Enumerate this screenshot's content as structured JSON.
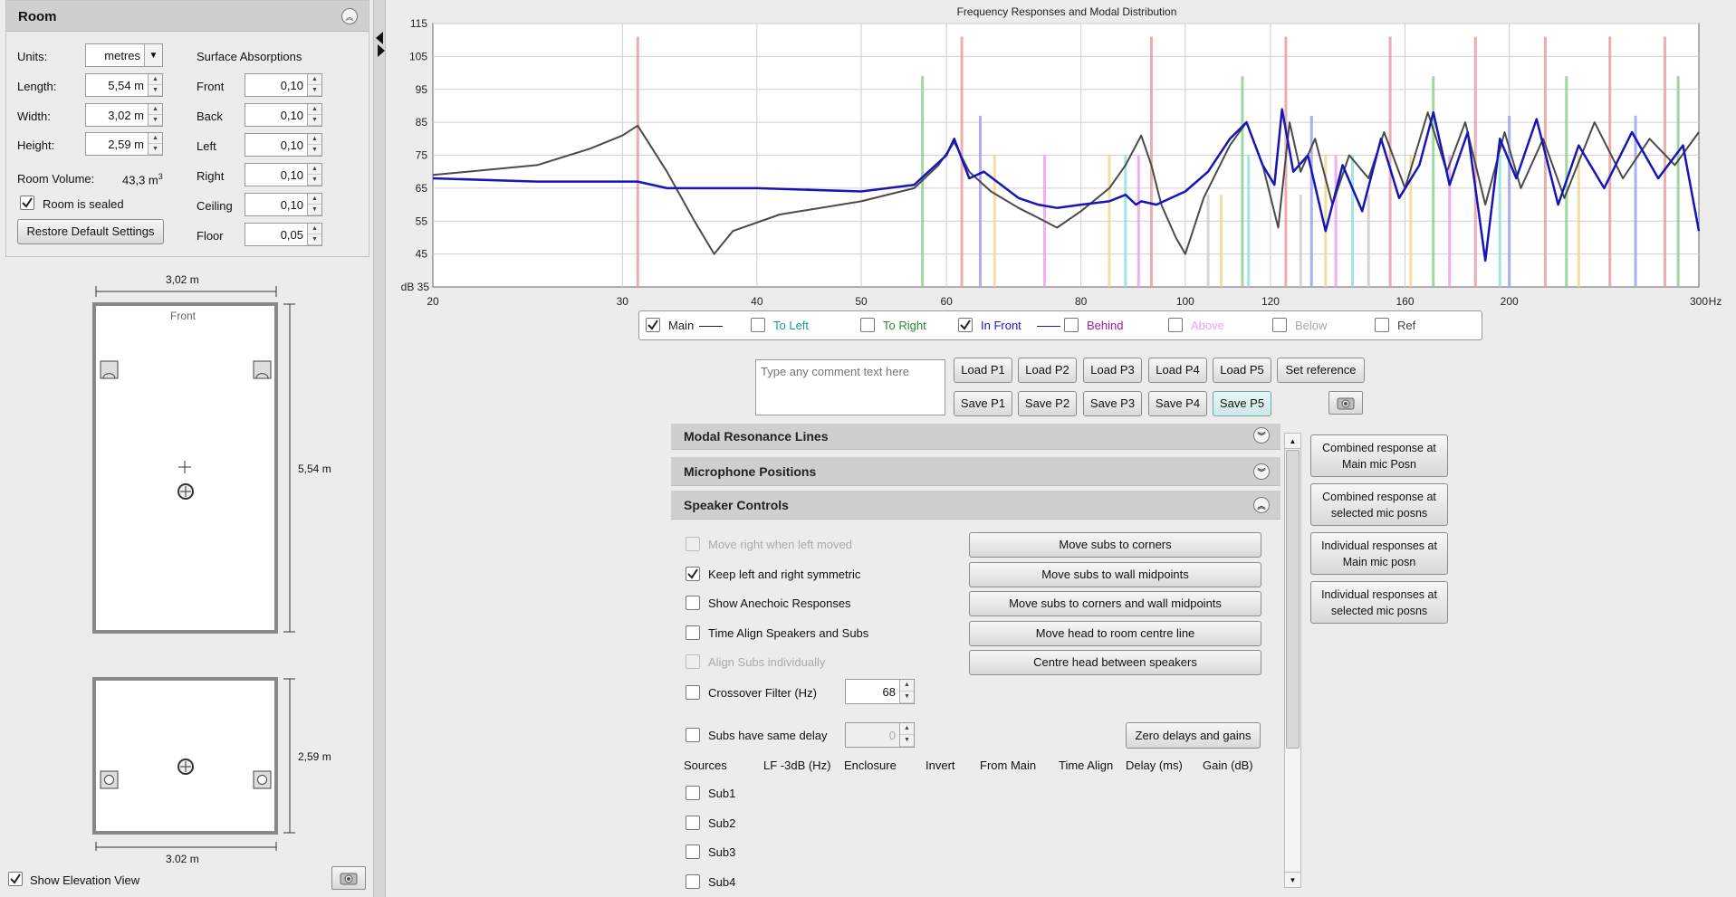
{
  "room": {
    "title": "Room",
    "units_label": "Units:",
    "units_value": "metres",
    "length_label": "Length:",
    "length_value": "5,54 m",
    "width_label": "Width:",
    "width_value": "3,02 m",
    "height_label": "Height:",
    "height_value": "2,59 m",
    "volume_label": "Room Volume:",
    "volume_value": "43,3 m",
    "volume_sup": "3",
    "sealed_label": "Room is sealed",
    "sealed_checked": true,
    "restore_label": "Restore Default Settings",
    "absorption_title": "Surface Absorptions",
    "absorptions": [
      {
        "label": "Front",
        "value": "0,10"
      },
      {
        "label": "Back",
        "value": "0,10"
      },
      {
        "label": "Left",
        "value": "0,10"
      },
      {
        "label": "Right",
        "value": "0,10"
      },
      {
        "label": "Ceiling",
        "value": "0,10"
      },
      {
        "label": "Floor",
        "value": "0,05"
      }
    ]
  },
  "plan": {
    "width_dim": "3,02 m",
    "length_dim": "5,54 m",
    "front_label": "Front",
    "elev_width_dim": "3.02 m",
    "elev_height_dim": "2,59 m",
    "show_elevation_label": "Show Elevation View",
    "show_elevation_checked": true
  },
  "chart_data": {
    "type": "line",
    "title": "Frequency Responses and Modal Distribution",
    "xscale": "log",
    "xlim": [
      20,
      300
    ],
    "ylim": [
      35,
      115
    ],
    "xticks": [
      20,
      30,
      40,
      50,
      60,
      80,
      100,
      120,
      160,
      200,
      300
    ],
    "yticks": [
      45,
      55,
      65,
      75,
      85,
      95,
      105,
      115
    ],
    "ylabel": "dB 35",
    "xunit": "Hz",
    "grid": true,
    "series": [
      {
        "name": "Main",
        "color": "#4a4a4a",
        "x": [
          20,
          25,
          28,
          30,
          31,
          33,
          35,
          36.5,
          38,
          42,
          50,
          56,
          59,
          61,
          63,
          66,
          70,
          73,
          76,
          80,
          85,
          88,
          91,
          93,
          95,
          98,
          100,
          104,
          110,
          114,
          118,
          122,
          125,
          128,
          132,
          137,
          142,
          148,
          153,
          160,
          168,
          175,
          182,
          190,
          198,
          205,
          215,
          225,
          240,
          255,
          270,
          285,
          300
        ],
        "y": [
          69,
          72,
          77,
          81,
          84,
          70,
          55,
          45,
          52,
          57,
          61,
          65,
          72,
          79,
          70,
          64,
          59,
          56,
          53,
          58,
          65,
          72,
          81,
          72,
          60,
          50,
          45,
          62,
          78,
          85,
          72,
          53,
          85,
          70,
          80,
          60,
          75,
          68,
          82,
          65,
          88,
          70,
          85,
          60,
          82,
          65,
          80,
          62,
          85,
          68,
          80,
          72,
          82
        ]
      },
      {
        "name": "In Front",
        "color": "#1616b8",
        "x": [
          20,
          25,
          30,
          31,
          33,
          40,
          50,
          56,
          60,
          61,
          63,
          65,
          70,
          73,
          76,
          80,
          85,
          88,
          90,
          91,
          94,
          100,
          105,
          110,
          114,
          118,
          121,
          123,
          126,
          130,
          135,
          140,
          146,
          152,
          158,
          165,
          170,
          176,
          183,
          190,
          196,
          203,
          212,
          222,
          232,
          245,
          260,
          275,
          290,
          300
        ],
        "y": [
          68,
          67,
          67,
          67,
          65,
          65,
          64,
          66,
          75,
          80,
          68,
          70,
          62,
          60,
          59,
          60,
          61,
          63,
          60,
          61,
          60,
          64,
          70,
          80,
          85,
          72,
          66,
          89,
          70,
          75,
          52,
          72,
          58,
          80,
          62,
          72,
          88,
          66,
          82,
          43,
          80,
          68,
          86,
          60,
          78,
          65,
          82,
          68,
          78,
          52
        ]
      }
    ],
    "modal_lines": [
      {
        "hz": 31,
        "db": 111,
        "kind": "axial"
      },
      {
        "hz": 57,
        "db": 99,
        "kind": "tangential-green"
      },
      {
        "hz": 62,
        "db": 111,
        "kind": "axial"
      },
      {
        "hz": 64.5,
        "db": 87,
        "kind": "blue"
      },
      {
        "hz": 66.5,
        "db": 75,
        "kind": "yellow"
      },
      {
        "hz": 74,
        "db": 75,
        "kind": "magenta"
      },
      {
        "hz": 85,
        "db": 75,
        "kind": "yellow"
      },
      {
        "hz": 88,
        "db": 75,
        "kind": "cyan"
      },
      {
        "hz": 90.5,
        "db": 75,
        "kind": "magenta"
      },
      {
        "hz": 93,
        "db": 111,
        "kind": "axial"
      },
      {
        "hz": 105,
        "db": 63,
        "kind": "grey"
      },
      {
        "hz": 108,
        "db": 63,
        "kind": "yellow"
      },
      {
        "hz": 113,
        "db": 99,
        "kind": "tangential-green"
      },
      {
        "hz": 114.5,
        "db": 75,
        "kind": "cyan"
      },
      {
        "hz": 124,
        "db": 111,
        "kind": "axial"
      },
      {
        "hz": 128,
        "db": 63,
        "kind": "grey"
      },
      {
        "hz": 131,
        "db": 87,
        "kind": "blue"
      },
      {
        "hz": 135,
        "db": 75,
        "kind": "yellow"
      },
      {
        "hz": 138,
        "db": 75,
        "kind": "magenta"
      },
      {
        "hz": 143,
        "db": 75,
        "kind": "cyan"
      },
      {
        "hz": 148,
        "db": 63,
        "kind": "grey"
      },
      {
        "hz": 155,
        "db": 111,
        "kind": "axial"
      },
      {
        "hz": 162,
        "db": 75,
        "kind": "yellow"
      },
      {
        "hz": 170,
        "db": 99,
        "kind": "tangential-green"
      },
      {
        "hz": 176,
        "db": 75,
        "kind": "magenta"
      },
      {
        "hz": 186,
        "db": 111,
        "kind": "axial"
      },
      {
        "hz": 196,
        "db": 75,
        "kind": "cyan"
      },
      {
        "hz": 200,
        "db": 87,
        "kind": "blue"
      },
      {
        "hz": 216,
        "db": 111,
        "kind": "axial"
      },
      {
        "hz": 226,
        "db": 99,
        "kind": "tangential-green"
      },
      {
        "hz": 232,
        "db": 75,
        "kind": "yellow"
      },
      {
        "hz": 248,
        "db": 111,
        "kind": "axial"
      },
      {
        "hz": 262,
        "db": 87,
        "kind": "blue"
      },
      {
        "hz": 279,
        "db": 111,
        "kind": "axial"
      },
      {
        "hz": 287,
        "db": 99,
        "kind": "tangential-green"
      }
    ],
    "legend": [
      {
        "label": "Main",
        "checked": true,
        "color": "#222222",
        "line": true
      },
      {
        "label": "To Left",
        "checked": false,
        "color": "#1a9c8c",
        "line": false
      },
      {
        "label": "To Right",
        "checked": false,
        "color": "#2a8a2a",
        "line": false
      },
      {
        "label": "In Front",
        "checked": true,
        "color": "#1a1ab8",
        "line": true
      },
      {
        "label": "Behind",
        "checked": false,
        "color": "#a01aa0",
        "line": false
      },
      {
        "label": "Above",
        "checked": false,
        "color": "#f0a0f0",
        "line": false
      },
      {
        "label": "Below",
        "checked": false,
        "color": "#a8a8a8",
        "line": false
      },
      {
        "label": "Ref",
        "checked": false,
        "color": "#444444",
        "line": false
      }
    ]
  },
  "comment": {
    "placeholder": "Type any comment text here"
  },
  "load_buttons": [
    "Load P1",
    "Load P2",
    "Load P3",
    "Load P4",
    "Load P5"
  ],
  "save_buttons": [
    "Save P1",
    "Save P2",
    "Save P3",
    "Save P4",
    "Save P5"
  ],
  "set_reference_label": "Set reference",
  "sections": {
    "modal": "Modal Resonance Lines",
    "mic": "Microphone Positions",
    "speaker": "Speaker Controls"
  },
  "speaker_controls": {
    "options": [
      {
        "label": "Move right when left moved",
        "checked": false,
        "disabled": true
      },
      {
        "label": "Keep left and right symmetric",
        "checked": true,
        "disabled": false
      },
      {
        "label": "Show Anechoic Responses",
        "checked": false,
        "disabled": false
      },
      {
        "label": "Time Align Speakers and Subs",
        "checked": false,
        "disabled": false
      },
      {
        "label": "Align Subs individually",
        "checked": false,
        "disabled": true
      }
    ],
    "crossover_label": "Crossover Filter (Hz)",
    "crossover_value": "68",
    "same_delay_label": "Subs have same delay",
    "same_delay_value": "0",
    "move_buttons": [
      "Move subs to corners",
      "Move subs to wall midpoints",
      "Move subs to corners and wall midpoints",
      "Move head to room centre line",
      "Centre head between speakers"
    ],
    "zero_button": "Zero delays and gains",
    "columns": [
      "Sources",
      "LF -3dB (Hz)",
      "Enclosure",
      "Invert",
      "From Main",
      "Time Align",
      "Delay (ms)",
      "Gain (dB)"
    ],
    "subs": [
      "Sub1",
      "Sub2",
      "Sub3",
      "Sub4"
    ]
  },
  "side_buttons": [
    [
      "Combined response at",
      "Main mic Posn"
    ],
    [
      "Combined response at",
      "selected mic posns"
    ],
    [
      "Individual responses at",
      "Main mic posn"
    ],
    [
      "Individual responses at",
      "selected mic posns"
    ]
  ],
  "colors": {
    "axial": "#e8a0a0",
    "tangential-green": "#8fd08f",
    "blue": "#a0a0f0",
    "yellow": "#f0d890",
    "magenta": "#f0a0f0",
    "cyan": "#90e0e0",
    "grey": "#cccccc"
  }
}
